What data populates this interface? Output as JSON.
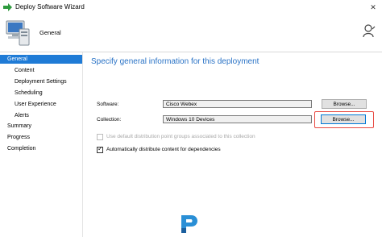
{
  "window": {
    "title": "Deploy Software Wizard"
  },
  "header": {
    "title": "General"
  },
  "sidebar": {
    "items": [
      {
        "label": "General"
      },
      {
        "label": "Content"
      },
      {
        "label": "Deployment Settings"
      },
      {
        "label": "Scheduling"
      },
      {
        "label": "User Experience"
      },
      {
        "label": "Alerts"
      },
      {
        "label": "Summary"
      },
      {
        "label": "Progress"
      },
      {
        "label": "Completion"
      }
    ]
  },
  "main": {
    "heading": "Specify general information for this deployment",
    "software": {
      "label": "Software:",
      "value": "Cisco Webex",
      "browse": "Browse..."
    },
    "collection": {
      "label": "Collection:",
      "value": "Windows 10 Devices",
      "browse": "Browse..."
    },
    "checkbox_default_dp": {
      "label": "Use default distribution point groups associated to this collection",
      "checked": false,
      "enabled": false
    },
    "checkbox_auto_distribute": {
      "label": "Automatically distribute content for dependencies",
      "checked": true,
      "enabled": true
    }
  },
  "colors": {
    "accent": "#1f7bd6",
    "heading": "#2a73c6",
    "highlight": "#e8473f"
  }
}
